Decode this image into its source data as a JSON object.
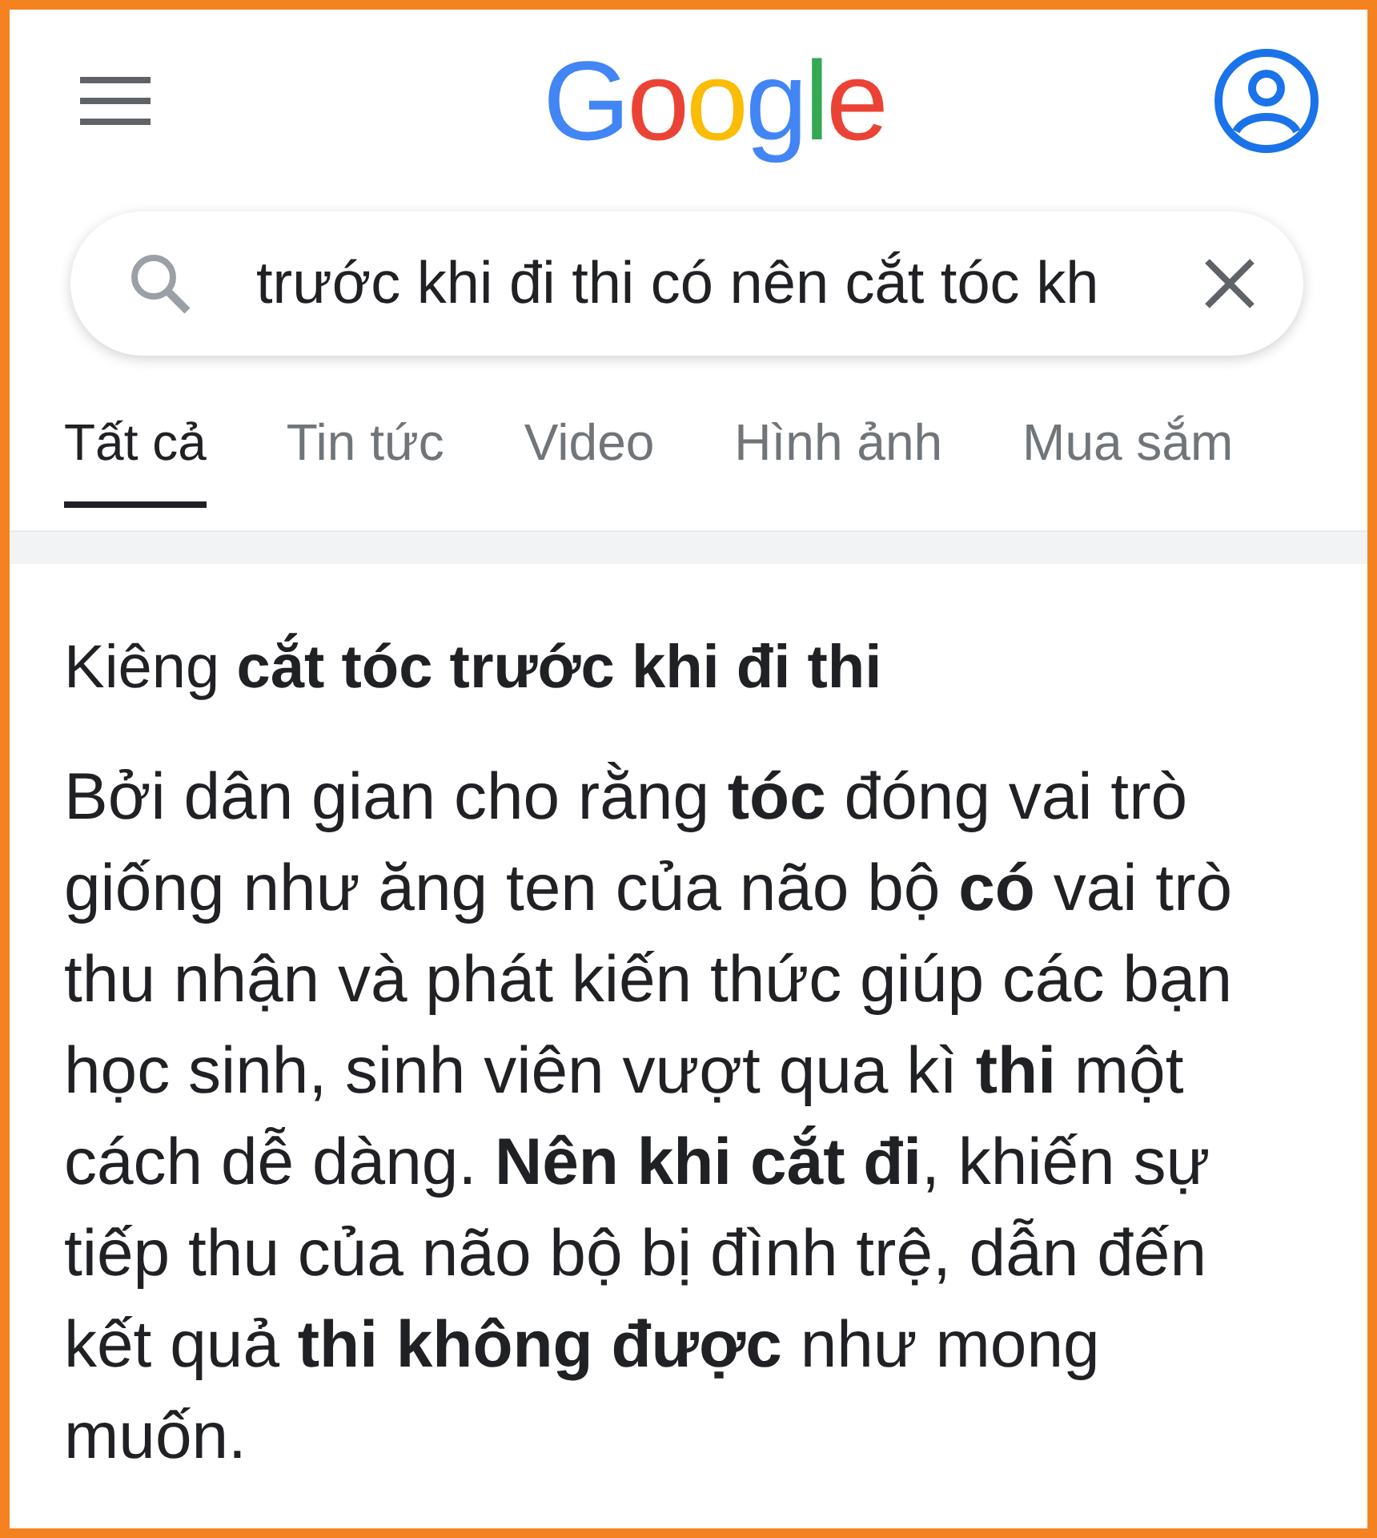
{
  "header": {
    "logo": "Google"
  },
  "search": {
    "value": "trước khi đi thi có nên cắt tóc kh"
  },
  "tabs": [
    {
      "label": "Tất cả",
      "selected": true
    },
    {
      "label": "Tin tức",
      "selected": false
    },
    {
      "label": "Video",
      "selected": false
    },
    {
      "label": "Hình ảnh",
      "selected": false
    },
    {
      "label": "Mua sắm",
      "selected": false
    }
  ],
  "result": {
    "title": "Kiêng **cắt tóc trước khi đi thi**",
    "snippet": "Bởi dân gian cho rằng **tóc** đóng vai trò giống như ăng ten của não bộ **có** vai trò thu nhận và phát kiến thức giúp các bạn học sinh, sinh viên vượt qua kì **thi** một cách dễ dàng. **Nên khi cắt đi**, khiến sự tiếp thu của não bộ bị đình trệ, dẫn đến kết quả **thi không được** như mong muốn."
  }
}
